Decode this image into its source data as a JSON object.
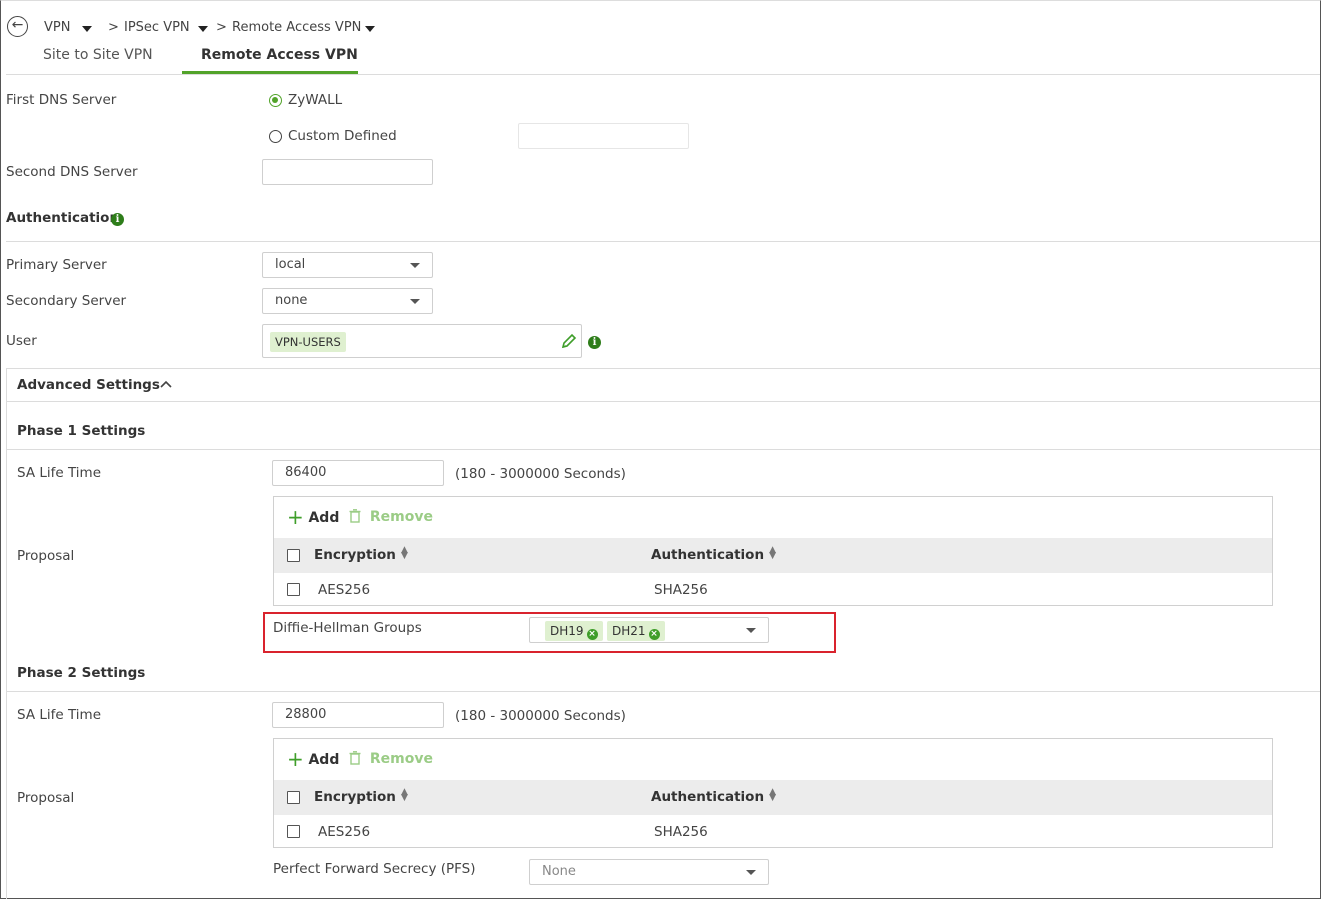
{
  "breadcrumb": {
    "items": [
      "VPN",
      "IPSec VPN",
      "Remote Access VPN"
    ],
    "separator": ">"
  },
  "tabs": [
    {
      "label": "Site to Site VPN",
      "active": false
    },
    {
      "label": "Remote Access VPN",
      "active": true
    }
  ],
  "dns": {
    "first_label": "First DNS Server",
    "option_zywall": "ZyWALL",
    "option_custom": "Custom Defined",
    "selected": "ZyWALL",
    "custom_value": "",
    "second_label": "Second DNS Server",
    "second_value": ""
  },
  "authentication": {
    "heading": "Authentication",
    "primary_label": "Primary Server",
    "primary_value": "local",
    "secondary_label": "Secondary Server",
    "secondary_value": "none",
    "user_label": "User",
    "user_chip": "VPN-USERS"
  },
  "advanced": {
    "heading": "Advanced Settings",
    "phase1": {
      "heading": "Phase 1 Settings",
      "sa_label": "SA Life Time",
      "sa_value": "86400",
      "sa_hint": "(180 - 3000000 Seconds)",
      "proposal_label": "Proposal",
      "add_label": "Add",
      "remove_label": "Remove",
      "columns": [
        "Encryption",
        "Authentication"
      ],
      "rows": [
        {
          "encryption": "AES256",
          "authentication": "SHA256"
        }
      ],
      "dh_label": "Diffie-Hellman Groups",
      "dh_chips": [
        "DH19",
        "DH21"
      ]
    },
    "phase2": {
      "heading": "Phase 2 Settings",
      "sa_label": "SA Life Time",
      "sa_value": "28800",
      "sa_hint": "(180 - 3000000 Seconds)",
      "proposal_label": "Proposal",
      "add_label": "Add",
      "remove_label": "Remove",
      "columns": [
        "Encryption",
        "Authentication"
      ],
      "rows": [
        {
          "encryption": "AES256",
          "authentication": "SHA256"
        }
      ],
      "pfs_label": "Perfect Forward Secrecy (PFS)",
      "pfs_value": "None"
    }
  },
  "colors": {
    "accent": "#52a32a",
    "highlight": "#d9232d",
    "chip_bg": "#dff0d0"
  }
}
